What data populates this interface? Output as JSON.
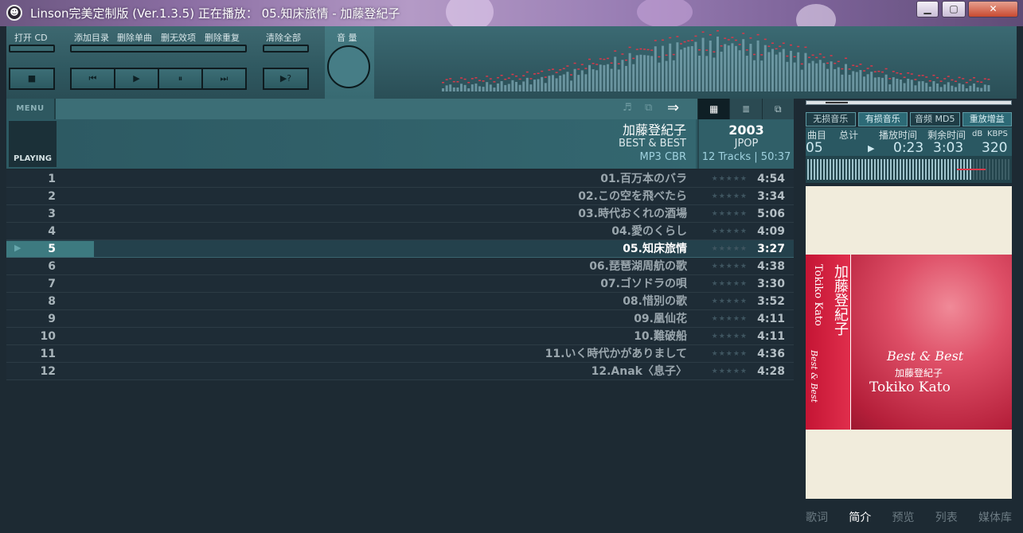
{
  "window": {
    "title": "Linson完美定制版 (Ver.1.3.5)    正在播放： 05.知床旅情 - 加藤登紀子",
    "minimize": "▁",
    "maximize": "▢",
    "close": "✕"
  },
  "toolbar": {
    "open_cd": "打开 CD",
    "add_dir": "添加目录",
    "del_single": "删除单曲",
    "del_invalid": "删无效项",
    "del_dup": "删除重复",
    "clear_all": "清除全部",
    "volume": "音 量",
    "stop": "■",
    "prev": "⏮",
    "play": "▶",
    "pause": "⏸",
    "next": "⏭",
    "mode": "▶?"
  },
  "menu": {
    "label": "MENU",
    "note_icon": "♬",
    "tab_icon": "⧉",
    "shuffle_icon": "⇒"
  },
  "view_tabs": [
    "▦",
    "≣",
    "⧉"
  ],
  "album": {
    "playing_tab": "PLAYING",
    "artist": "加藤登紀子",
    "album": "BEST & BEST",
    "format": "MP3 CBR",
    "year": "2003",
    "genre": "JPOP",
    "tracks": "12 Tracks | 50:37"
  },
  "playlist": [
    {
      "n": "1",
      "name": "01.百万本のバラ",
      "dur": "4:54"
    },
    {
      "n": "2",
      "name": "02.この空を飛べたら",
      "dur": "3:34"
    },
    {
      "n": "3",
      "name": "03.時代おくれの酒場",
      "dur": "5:06"
    },
    {
      "n": "4",
      "name": "04.愛のくらし",
      "dur": "4:09"
    },
    {
      "n": "5",
      "name": "05.知床旅情",
      "dur": "3:27",
      "playing": true
    },
    {
      "n": "6",
      "name": "06.琵琶湖周航の歌",
      "dur": "4:38"
    },
    {
      "n": "7",
      "name": "07.ゴソドラの唄",
      "dur": "3:30"
    },
    {
      "n": "8",
      "name": "08.惜別の歌",
      "dur": "3:52"
    },
    {
      "n": "9",
      "name": "09.凰仙花",
      "dur": "4:11"
    },
    {
      "n": "10",
      "name": "10.難破船",
      "dur": "4:11"
    },
    {
      "n": "11",
      "name": "11.いく時代かがありまして",
      "dur": "4:36"
    },
    {
      "n": "12",
      "name": "12.Anak〈息子〉",
      "dur": "4:28"
    }
  ],
  "stars": "★★★★★",
  "right": {
    "tags": [
      "无损音乐",
      "有损音乐",
      "音频 MD5",
      "重放增益"
    ],
    "labels": {
      "track": "曲目",
      "total": "总计",
      "played": "播放时间",
      "remain": "剩余时间",
      "db": "dB",
      "kbps": "KBPS"
    },
    "values": {
      "track": "05",
      "play_icon": "▶",
      "played": "0:23",
      "remain": "3:03",
      "kbps": "320"
    },
    "cover": {
      "vert_name": "加藤登紀子",
      "vert_en": "Tokiko Kato",
      "spine_best": "Best & Best",
      "title": "Best & Best",
      "jp": "加藤登紀子",
      "en": "Tokiko Kato"
    },
    "bottom_tabs": [
      "歌词",
      "简介",
      "预览",
      "列表",
      "媒体库"
    ]
  },
  "colors": {
    "accent": "#3d7a80",
    "bg": "#1d2a33",
    "spectrum_red": "#d8394a"
  }
}
